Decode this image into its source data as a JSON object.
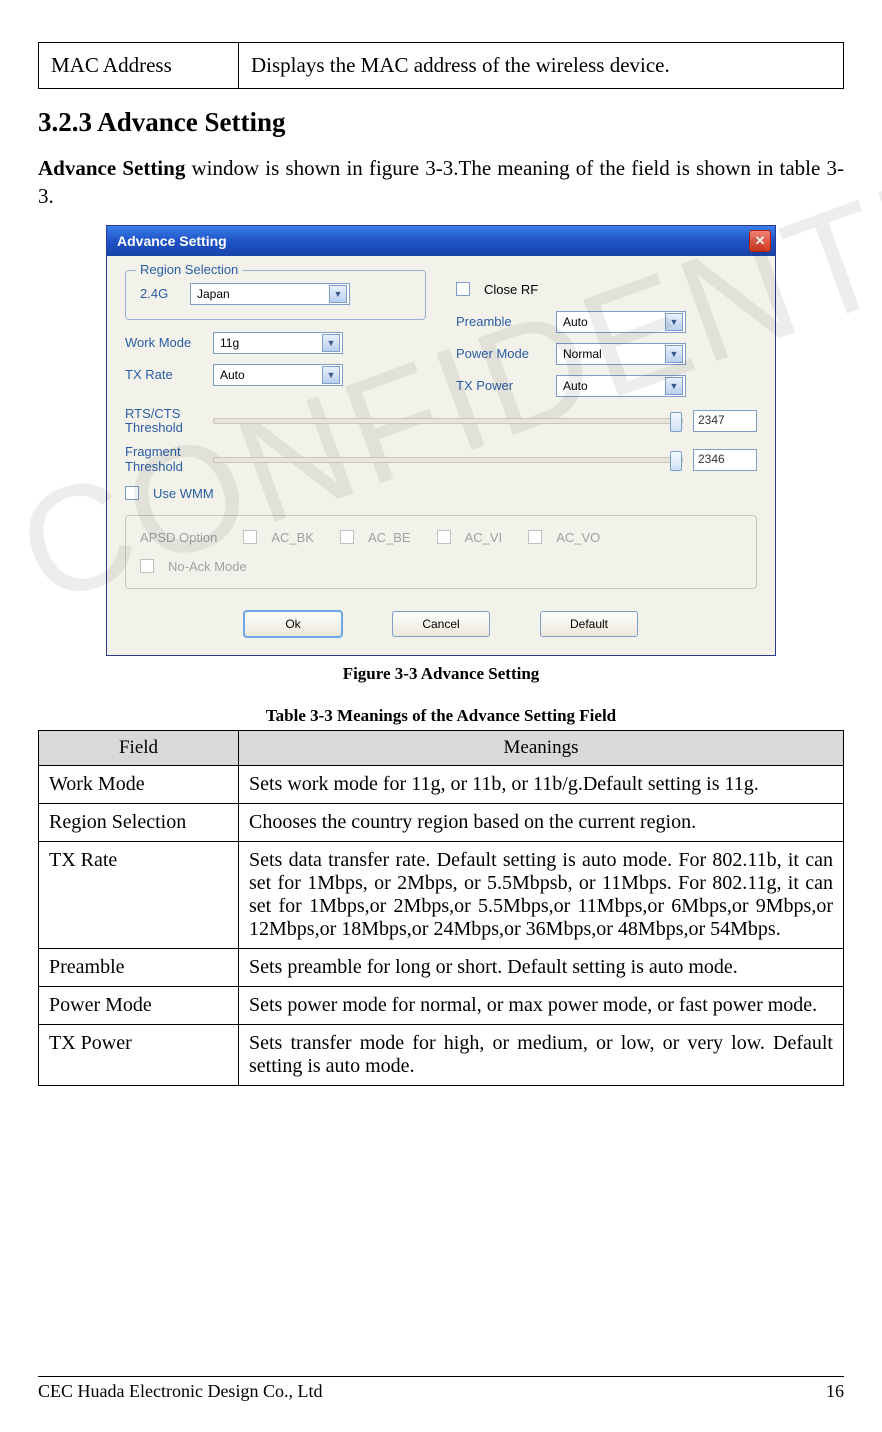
{
  "top_table": {
    "field": "MAC Address",
    "meaning": "Displays the MAC address of the wireless device."
  },
  "section_heading": "3.2.3 Advance Setting",
  "intro": {
    "bold": "Advance Setting",
    "rest": " window is shown in figure 3-3.The meaning of the field is shown in table 3-3."
  },
  "window": {
    "title": "Advance Setting",
    "region_legend": "Region Selection",
    "region_label": "2.4G",
    "region_value": "Japan",
    "work_mode_label": "Work Mode",
    "work_mode_value": "11g",
    "tx_rate_label": "TX Rate",
    "tx_rate_value": "Auto",
    "close_rf_label": "Close RF",
    "preamble_label": "Preamble",
    "preamble_value": "Auto",
    "power_mode_label": "Power Mode",
    "power_mode_value": "Normal",
    "tx_power_label": "TX Power",
    "tx_power_value": "Auto",
    "rts_label": "RTS/CTS Threshold",
    "rts_value": "2347",
    "frag_label": "Fragment Threshold",
    "frag_value": "2346",
    "use_wmm_label": "Use WMM",
    "apsd_label": "APSD Option",
    "ac_bk": "AC_BK",
    "ac_be": "AC_BE",
    "ac_vi": "AC_VI",
    "ac_vo": "AC_VO",
    "noack": "No-Ack Mode",
    "ok": "Ok",
    "cancel": "Cancel",
    "default": "Default"
  },
  "fig_caption": "Figure 3-3 Advance Setting",
  "table_caption": "Table 3-3 Meanings of the Advance Setting Field",
  "table_header": {
    "field": "Field",
    "meanings": "Meanings"
  },
  "rows": [
    {
      "field": "Work Mode",
      "meaning": "Sets work mode for 11g, or 11b, or 11b/g.Default setting is 11g."
    },
    {
      "field": "Region Selection",
      "meaning": "Chooses the country region based on the current region."
    },
    {
      "field": "TX Rate",
      "meaning": "Sets data transfer rate. Default setting is auto mode. For 802.11b, it can set for 1Mbps, or 2Mbps, or 5.5Mbpsb, or 11Mbps. For 802.11g, it can set for 1Mbps,or 2Mbps,or 5.5Mbps,or 11Mbps,or 6Mbps,or 9Mbps,or 12Mbps,or 18Mbps,or 24Mbps,or 36Mbps,or 48Mbps,or 54Mbps."
    },
    {
      "field": "Preamble",
      "meaning": "Sets preamble for long or short. Default setting is auto mode."
    },
    {
      "field": "Power Mode",
      "meaning": "Sets power mode for normal, or max power mode, or fast power mode."
    },
    {
      "field": "TX Power",
      "meaning": "Sets transfer mode for high, or medium, or low, or very low. Default setting is auto mode."
    }
  ],
  "footer": {
    "left": "CEC Huada Electronic Design Co., Ltd",
    "right": "16"
  }
}
